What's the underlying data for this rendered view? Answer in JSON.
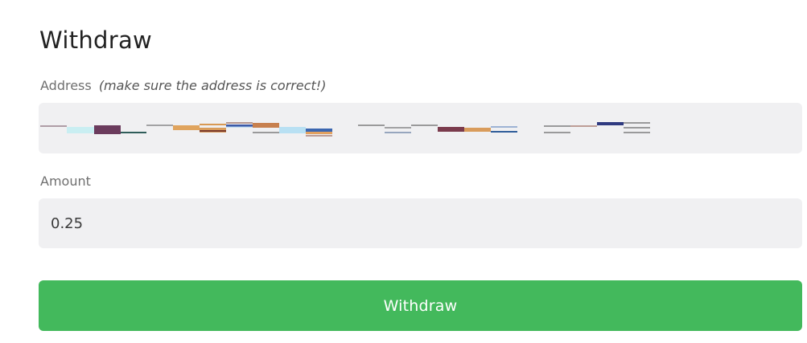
{
  "form": {
    "title": "Withdraw",
    "address_label": "Address",
    "address_hint": "(make sure the address is correct!)",
    "amount_label": "Amount",
    "amount_value": "0.25",
    "submit_label": "Withdraw"
  },
  "colors": {
    "accent": "#43b95c",
    "field_background": "#f0f0f2"
  }
}
